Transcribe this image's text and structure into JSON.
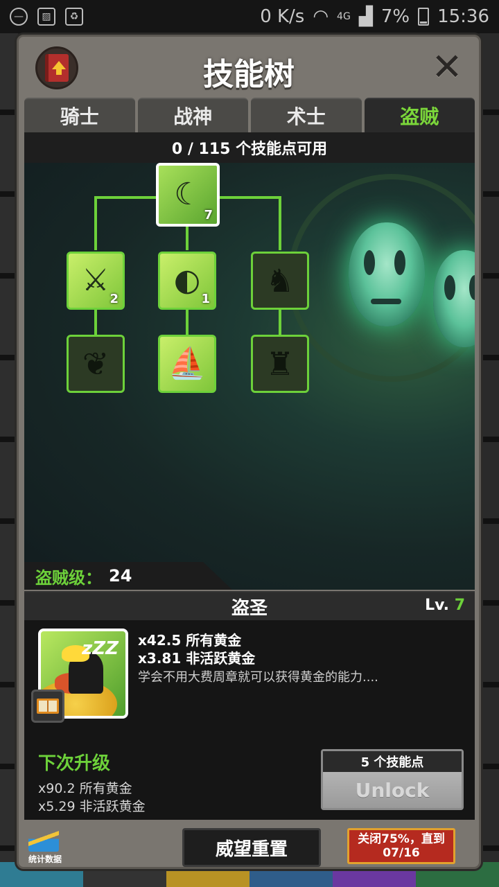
{
  "status_bar": {
    "network_speed": "0 K/s",
    "network_type": "4G",
    "battery": "7%",
    "time": "15:36"
  },
  "modal": {
    "title": "技能树",
    "close_glyph": "✕"
  },
  "tabs": [
    {
      "label": "骑士",
      "active": false
    },
    {
      "label": "战神",
      "active": false
    },
    {
      "label": "术士",
      "active": false
    },
    {
      "label": "盗贼",
      "active": true
    }
  ],
  "skill_points": "0 / 115 个技能点可用",
  "tree": {
    "nodes": [
      {
        "name": "盗圣",
        "level": "7",
        "icon": "sleeping-thief-icon",
        "state": "selected"
      },
      {
        "name": "sword-strike",
        "level": "2",
        "icon": "sword-icon",
        "state": "unlocked"
      },
      {
        "name": "world-travel",
        "level": "1",
        "icon": "globe-icon",
        "state": "unlocked"
      },
      {
        "name": "shadow-creatures",
        "level": "",
        "icon": "shadow-creatures-icon",
        "state": "locked"
      },
      {
        "name": "shadow-bat",
        "level": "",
        "icon": "bat-icon",
        "state": "locked"
      },
      {
        "name": "ghost-ship",
        "level": "",
        "icon": "ship-icon",
        "state": "unlocked"
      },
      {
        "name": "shadow-warrior",
        "level": "",
        "icon": "warrior-icon",
        "state": "locked"
      }
    ]
  },
  "class_level": {
    "label": "盗贼级：",
    "value": "24"
  },
  "detail": {
    "name": "盗圣",
    "level_prefix": "Lv.",
    "level": "7",
    "effects": [
      "x42.5 所有黄金",
      "x3.81 非活跃黄金"
    ],
    "description": "学会不用大费周章就可以获得黄金的能力....",
    "next_title": "下次升级",
    "next_effects": [
      "x90.2 所有黄金",
      "x5.29 非活跃黄金"
    ],
    "unlock_cost": "5 个技能点",
    "unlock_label": "Unlock"
  },
  "bottom": {
    "stats_label": "统计数据",
    "prestige_label": "威望重置",
    "sale_line1": "关闭75%，直到",
    "sale_line2": "07/16"
  },
  "colors": {
    "accent_green": "#6dd13a",
    "sale_red": "#b52a1f"
  }
}
